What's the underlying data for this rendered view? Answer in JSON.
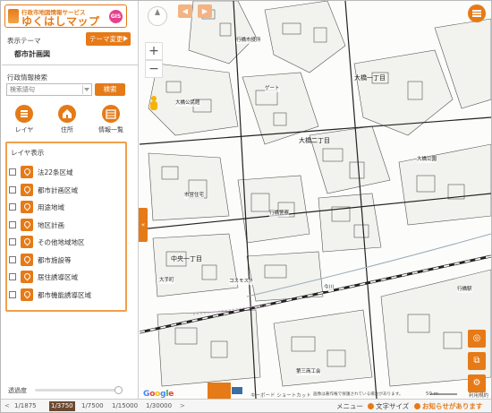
{
  "app": {
    "logo_sub": "行政市地図情報サービス",
    "logo_main": "ゆくはしマップ",
    "logo_badge": "GIS"
  },
  "sidebar": {
    "theme_label": "表示テーマ",
    "theme_button": "テーマ変更",
    "theme_name": "都市計画図",
    "search_label": "行政情報検索",
    "search_placeholder": "検索語句",
    "search_button": "検索",
    "tools": [
      {
        "label": "レイヤ",
        "icon": "layers-icon"
      },
      {
        "label": "住所",
        "icon": "home-icon"
      },
      {
        "label": "情報一覧",
        "icon": "list-icon"
      }
    ],
    "layer_panel_title": "レイヤ表示",
    "layers": [
      {
        "label": "法22条区域",
        "checked": false
      },
      {
        "label": "都市計画区域",
        "checked": false
      },
      {
        "label": "用途地域",
        "checked": false
      },
      {
        "label": "地区計画",
        "checked": false
      },
      {
        "label": "その他地域地区",
        "checked": false
      },
      {
        "label": "都市施設等",
        "checked": false
      },
      {
        "label": "居住誘導区域",
        "checked": false
      },
      {
        "label": "都市機能誘導区域",
        "checked": false
      }
    ],
    "opacity_label": "透過度",
    "opacity_value": 0.95
  },
  "map": {
    "labels": [
      {
        "text": "大橋一丁目",
        "bold": true
      },
      {
        "text": "大橋二丁目",
        "bold": true
      },
      {
        "text": "中央一丁目",
        "bold": true
      },
      {
        "text": "行橋市役所"
      },
      {
        "text": "ゲート"
      },
      {
        "text": "コスモスト"
      },
      {
        "text": "大橋公民館"
      },
      {
        "text": "行橋警察"
      },
      {
        "text": "今川"
      },
      {
        "text": "市営住宅"
      },
      {
        "text": "大手町"
      },
      {
        "text": "行橋駅"
      },
      {
        "text": "第三商工会"
      },
      {
        "text": "大橋公園"
      }
    ],
    "attribution_keys": "キーボード ショートカット",
    "attribution_data": "画像は著作権で保護されている場合があります。",
    "scale_text": "50 m",
    "terms": "利用規約",
    "google": "Google"
  },
  "footer": {
    "prev": "<",
    "scales": [
      "1/1875",
      "1/3750",
      "1/7500",
      "1/15000",
      "1/30000"
    ],
    "active_scale": "1/3750",
    "next": ">",
    "menu": "メニュー",
    "text_size": "文字サイズ",
    "notice": "お知らせがあります"
  },
  "colors": {
    "accent": "#e57a17",
    "active_scale_bg": "#6b4a32"
  }
}
